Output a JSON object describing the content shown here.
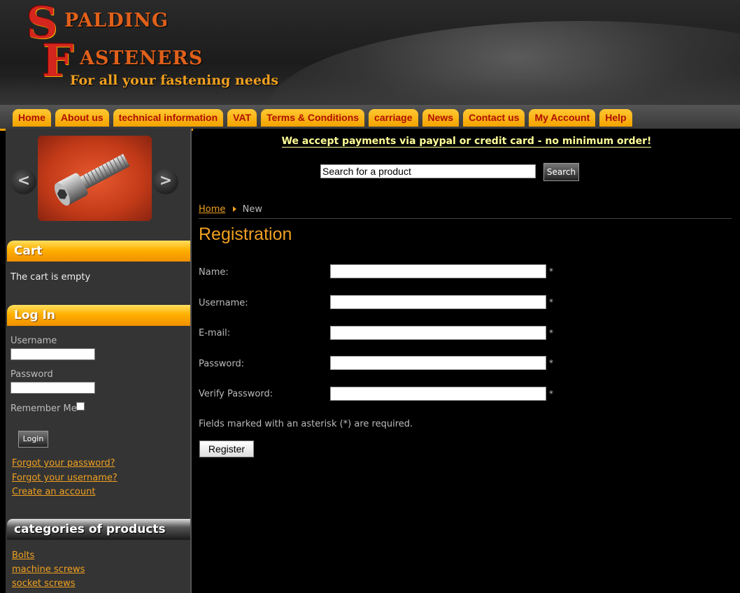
{
  "brand": {
    "letter1": "S",
    "word1": "PALDING",
    "letter2": "F",
    "word2": "ASTENERS",
    "tagline": "For all your fastening needs"
  },
  "nav": {
    "items": [
      "Home",
      "About us",
      "technical information",
      "VAT",
      "Terms & Conditions",
      "carriage",
      "News",
      "Contact us",
      "My Account",
      "Help"
    ]
  },
  "slideshow": {
    "prev_icon": "chevron-left-icon",
    "next_icon": "chevron-right-icon",
    "prev_glyph": "<",
    "next_glyph": ">"
  },
  "cart": {
    "title": "Cart",
    "status": "The cart is empty"
  },
  "login": {
    "title": "Log In",
    "username_label": "Username",
    "password_label": "Password",
    "remember_label": "Remember Me",
    "button": "Login",
    "links": [
      "Forgot your password?",
      "Forgot your username?",
      "Create an account"
    ]
  },
  "categories": {
    "title": "categories of products",
    "items": [
      "Bolts",
      "machine screws",
      "socket screws"
    ]
  },
  "main": {
    "notice": "We accept payments via paypal or credit card - no minimum order!",
    "search_value": "Search for a product",
    "search_button": "Search",
    "breadcrumb_home": "Home",
    "breadcrumb_current": "New",
    "title": "Registration",
    "fields": [
      "Name:",
      "Username:",
      "E-mail:",
      "Password:",
      "Verify Password:"
    ],
    "asterisk": "*",
    "required_note": "Fields marked with an asterisk (*) are required.",
    "register_button": "Register"
  },
  "colors": {
    "accent": "#f0a020",
    "nav_text": "#b01000",
    "notice": "#ffff99"
  }
}
